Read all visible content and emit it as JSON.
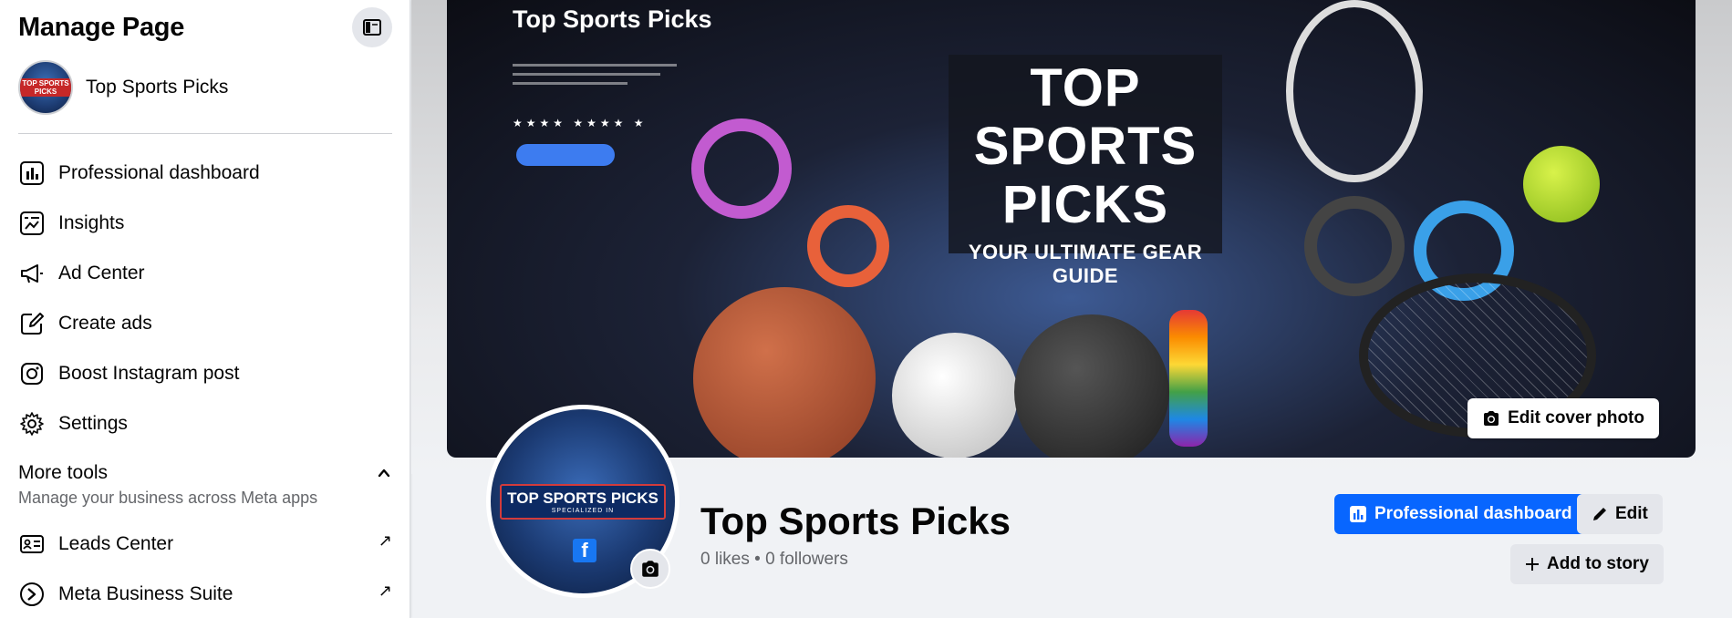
{
  "sidebar": {
    "title": "Manage Page",
    "page_name": "Top Sports Picks",
    "nav": [
      {
        "label": "Professional dashboard",
        "icon": "dashboard-icon"
      },
      {
        "label": "Insights",
        "icon": "insights-icon"
      },
      {
        "label": "Ad Center",
        "icon": "megaphone-icon"
      },
      {
        "label": "Create ads",
        "icon": "pencil-square-icon"
      },
      {
        "label": "Boost Instagram post",
        "icon": "instagram-icon"
      },
      {
        "label": "Settings",
        "icon": "gear-icon"
      }
    ],
    "more_tools": {
      "title": "More tools",
      "subtitle": "Manage your business across Meta apps"
    },
    "tools": [
      {
        "label": "Leads Center",
        "icon": "contact-card-icon"
      },
      {
        "label": "Meta Business Suite",
        "icon": "meta-suite-icon"
      }
    ]
  },
  "cover": {
    "label": "Top Sports Picks",
    "headline_line1": "TOP",
    "headline_line2": "SPORTS",
    "headline_line3": "PICKS",
    "tagline": "YOUR ULTIMATE GEAR GUIDE",
    "edit_button": "Edit cover photo"
  },
  "profile": {
    "avatar_text": "TOP SPORTS PICKS",
    "avatar_small": "SPECIALIZED IN",
    "name": "Top Sports Picks",
    "stats": "0 likes • 0 followers"
  },
  "actions": {
    "dashboard": "Professional dashboard",
    "edit": "Edit",
    "add_story": "Add to story"
  },
  "colors": {
    "primary": "#0866ff",
    "secondary_bg": "#e4e6eb",
    "text_muted": "#65676b"
  }
}
